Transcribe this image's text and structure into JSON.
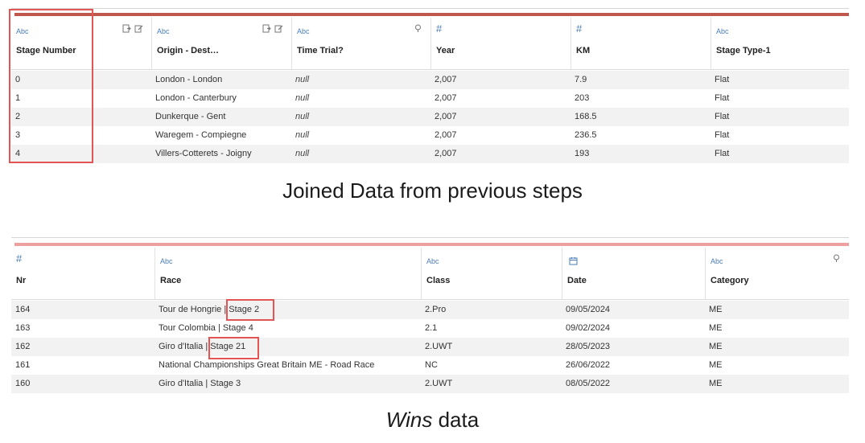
{
  "top_table": {
    "accent_color": "#c0574d",
    "columns": [
      {
        "type": "Abc",
        "name": "Stage Number"
      },
      {
        "type": "Abc",
        "name": "Origin - Dest…"
      },
      {
        "type": "Abc",
        "name": "Time Trial?"
      },
      {
        "type": "#",
        "name": "Year"
      },
      {
        "type": "#",
        "name": "KM"
      },
      {
        "type": "Abc",
        "name": "Stage Type-1"
      }
    ],
    "rows": [
      [
        "0",
        "London - London",
        "null",
        "2,007",
        "7.9",
        "Flat"
      ],
      [
        "1",
        "London - Canterbury",
        "null",
        "2,007",
        "203",
        "Flat"
      ],
      [
        "2",
        "Dunkerque - Gent",
        "null",
        "2,007",
        "168.5",
        "Flat"
      ],
      [
        "3",
        "Waregem - Compiegne",
        "null",
        "2,007",
        "236.5",
        "Flat"
      ],
      [
        "4",
        "Villers-Cotterets - Joigny",
        "null",
        "2,007",
        "193",
        "Flat"
      ]
    ]
  },
  "caption_top": "Joined Data from previous steps",
  "bottom_table": {
    "accent_color": "#eca0a0",
    "columns": [
      {
        "type": "#",
        "name": "Nr"
      },
      {
        "type": "Abc",
        "name": "Race"
      },
      {
        "type": "Abc",
        "name": "Class"
      },
      {
        "type": "date",
        "name": "Date"
      },
      {
        "type": "Abc",
        "name": "Category"
      }
    ],
    "rows": [
      [
        "164",
        "Tour de Hongrie | Stage 2",
        "2.Pro",
        "09/05/2024",
        "ME"
      ],
      [
        "163",
        "Tour Colombia | Stage 4",
        "2.1",
        "09/02/2024",
        "ME"
      ],
      [
        "162",
        "Giro d'Italia | Stage 21",
        "2.UWT",
        "28/05/2023",
        "ME"
      ],
      [
        "161",
        "National Championships Great Britain ME - Road Race",
        "NC",
        "26/06/2022",
        "ME"
      ],
      [
        "160",
        "Giro d'Italia | Stage 3",
        "2.UWT",
        "08/05/2022",
        "ME"
      ]
    ]
  },
  "caption_bottom_em": "Wins",
  "caption_bottom_rest": " data",
  "highlight_color": "#e35454"
}
